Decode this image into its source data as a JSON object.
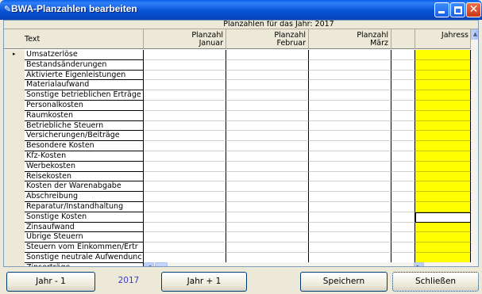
{
  "window": {
    "title": "BWA-Planzahlen bearbeiten",
    "icon": "pencil-icon",
    "controls": {
      "minimize": "_",
      "maximize": "□",
      "close": "✕"
    }
  },
  "grid": {
    "caption": "Planzahlen für das Jahr: 2017",
    "columns": {
      "text": "Text",
      "jan_1": "Planzahl",
      "jan_2": "Januar",
      "feb_1": "Planzahl",
      "feb_2": "Februar",
      "mar_1": "Planzahl",
      "mar_2": "März",
      "year": "Jahress"
    },
    "current_row_marker": "▸",
    "rows": [
      "Umsatzerlöse",
      "Bestandsänderungen",
      "Aktivierte Eigenleistungen",
      "Materialaufwand",
      "Sonstige betrieblichen Erträge",
      "Personalkosten",
      "Raumkosten",
      "Betriebliche Steuern",
      "Versicherungen/Beiträge",
      "Besondere Kosten",
      "Kfz-Kosten",
      "Werbekosten",
      "Reisekosten",
      "Kosten der Warenabgabe",
      "Abschreibung",
      "Reparatur/Instandhaltung",
      "Sonstige Kosten",
      "Zinsaufwand",
      "Übrige Steuern",
      "Steuern vom Einkommen/Ertr",
      "Sonstige neutrale Aufwendunc",
      "Zinserträge"
    ],
    "year_column_color": "#ffff00"
  },
  "buttons": {
    "prev_year": "Jahr - 1",
    "year_value": "2017",
    "next_year": "Jahr + 1",
    "save": "Speichern",
    "close": "Schließen"
  }
}
